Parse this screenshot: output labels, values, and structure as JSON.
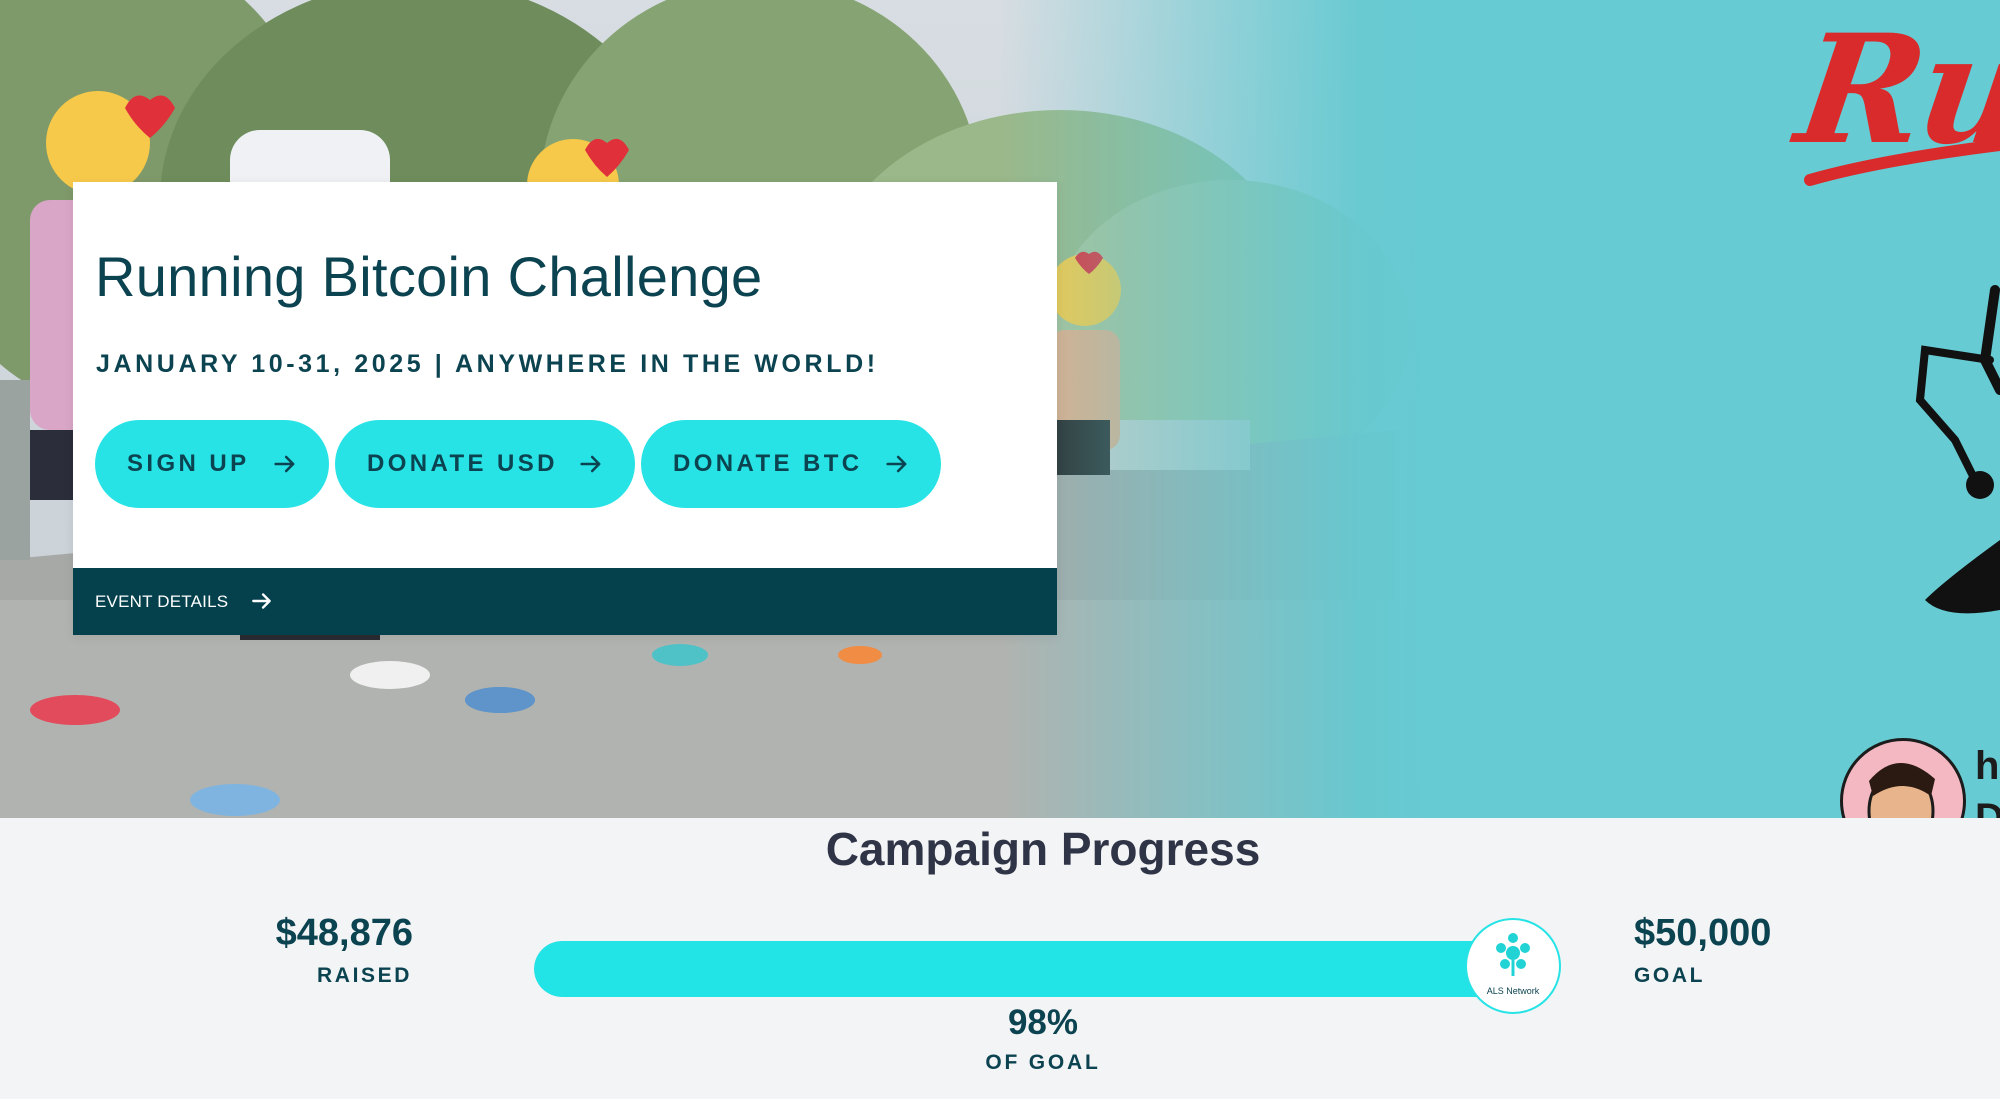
{
  "event": {
    "title": "Running Bitcoin Challenge",
    "subtitle": "JANUARY 10-31, 2025 | ANYWHERE IN THE WORLD!",
    "buttons": {
      "signup": "SIGN UP",
      "donate_usd": "DONATE USD",
      "donate_btc": "DONATE BTC"
    },
    "details_link": "EVENT DETAILS"
  },
  "poster": {
    "title_fragment": "Runn",
    "text_lines": [
      "h",
      "D"
    ]
  },
  "progress": {
    "heading": "Campaign Progress",
    "raised": "$48,876",
    "raised_label": "RAISED",
    "goal": "$50,000",
    "goal_label": "GOAL",
    "percent": "98%",
    "percent_label": "OF GOAL",
    "fill_fraction": 0.98,
    "badge_label": "ALS Network"
  },
  "colors": {
    "accent": "#27e3e5",
    "dark_teal": "#05414d",
    "poster_bg": "#66cbd3",
    "poster_red": "#d92b2b"
  },
  "icons": [
    "arrow-right-icon",
    "als-network-logo-icon"
  ]
}
